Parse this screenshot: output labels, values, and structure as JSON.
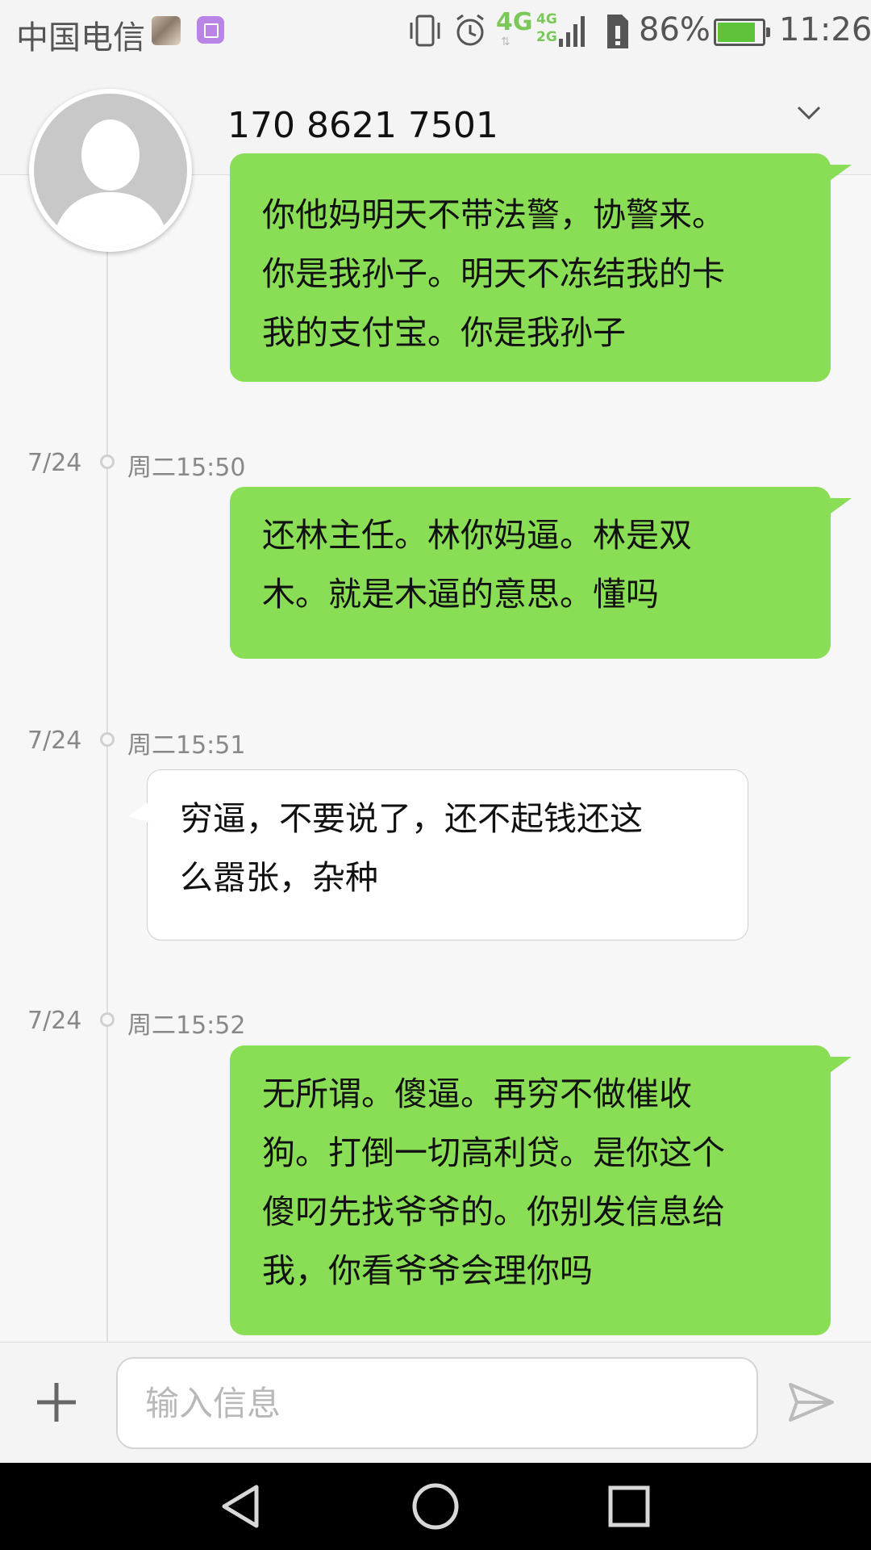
{
  "status_bar": {
    "carrier": "中国电信",
    "battery_percent": "86%",
    "battery_level": 0.86,
    "time": "11:26",
    "network_4g": "4G",
    "network_4g_small": "4G",
    "network_2g_small": "2G",
    "icons": [
      "photo-thumbnail-icon",
      "gallery-icon",
      "vibrate-icon",
      "alarm-icon",
      "signal-icon",
      "sim-icon",
      "battery-charging-icon"
    ]
  },
  "header": {
    "contact_number": "170 8621 7501",
    "menu_icon": "chevron-down-icon"
  },
  "messages": [
    {
      "direction": "outgoing",
      "date": "",
      "time": "",
      "lines": [
        "你他妈明天不带法警，协警来。",
        "你是我孙子。明天不冻结我的卡",
        "我的支付宝。你是我孙子"
      ]
    },
    {
      "direction": "outgoing",
      "date": "7/24",
      "time": "周二15:50",
      "lines": [
        "还林主任。林你妈逼。林是双",
        "木。就是木逼的意思。懂吗"
      ]
    },
    {
      "direction": "incoming",
      "date": "7/24",
      "time": "周二15:51",
      "lines": [
        "穷逼，不要说了，还不起钱还这",
        "么嚣张，杂种"
      ]
    },
    {
      "direction": "outgoing",
      "date": "7/24",
      "time": "周二15:52",
      "lines": [
        "无所谓。傻逼。再穷不做催收",
        "狗。打倒一切高利贷。是你这个",
        "傻叼先找爷爷的。你别发信息给",
        "我，你看爷爷会理你吗"
      ]
    }
  ],
  "compose": {
    "placeholder": "输入信息",
    "value": "",
    "add_icon": "plus-icon",
    "send_icon": "send-icon"
  },
  "nav_bar": {
    "icons": [
      "back-icon",
      "home-icon",
      "recents-icon"
    ]
  }
}
